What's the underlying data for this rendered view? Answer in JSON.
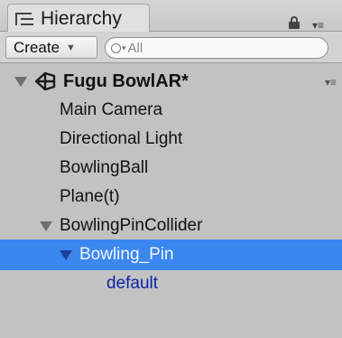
{
  "tab": {
    "title": "Hierarchy"
  },
  "toolbar": {
    "create_label": "Create",
    "search_placeholder": "All"
  },
  "scene": {
    "name": "Fugu BowlAR*"
  },
  "items": [
    {
      "label": "Main Camera"
    },
    {
      "label": "Directional Light"
    },
    {
      "label": "BowlingBall"
    },
    {
      "label": "Plane(t)"
    },
    {
      "label": "BowlingPinCollider"
    },
    {
      "label": "Bowling_Pin"
    },
    {
      "label": "default"
    }
  ],
  "colors": {
    "selection": "#3a87f0",
    "prefab_text": "#0b24a6",
    "panel": "#c2c2c2"
  },
  "icons": {
    "tab": "hierarchy-icon",
    "lock": "lock-icon",
    "menu": "panel-menu-icon",
    "search": "search-icon",
    "scene": "unity-scene-icon"
  }
}
